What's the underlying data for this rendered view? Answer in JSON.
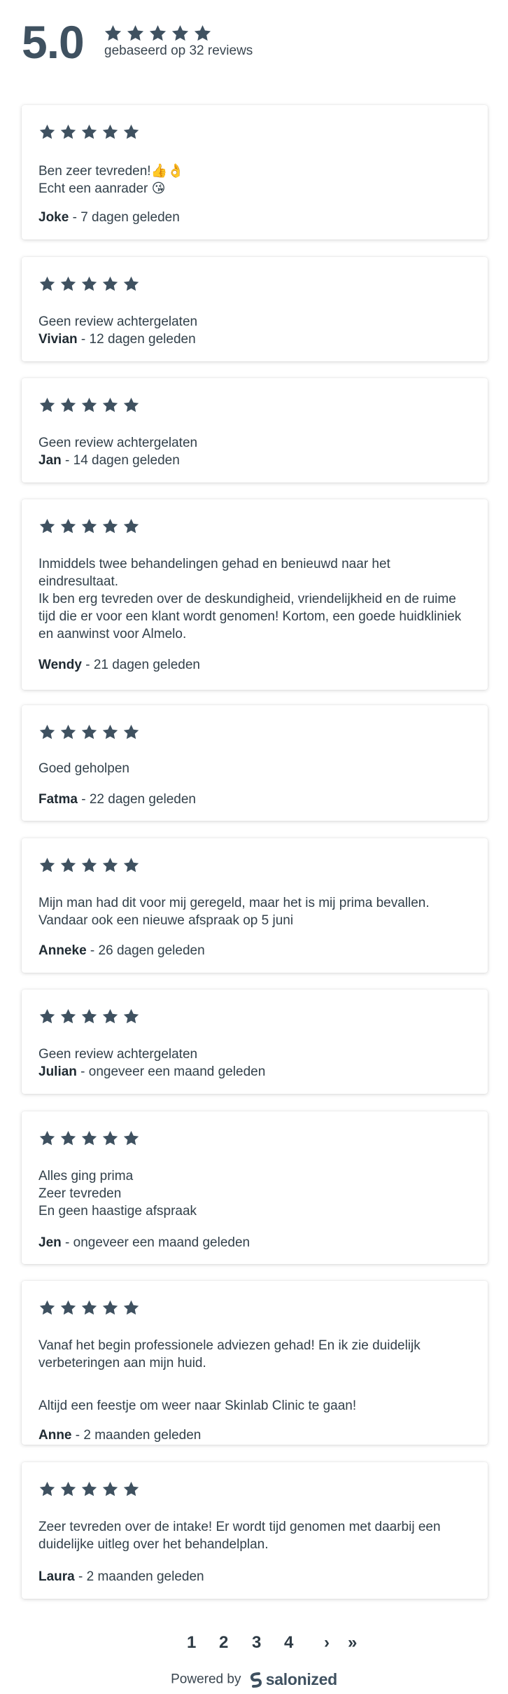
{
  "summary": {
    "score": "5.0",
    "count_label": "gebaseerd op 32 reviews",
    "rating": 5
  },
  "colors": {
    "star": "#3f5160",
    "text": "#33414b"
  },
  "reviews": [
    {
      "lines": [
        "Ben zeer tevreden!👍👌",
        "Echt een aanrader 😘"
      ],
      "name": "Joke",
      "when": " - 7 dagen geleden",
      "rating": 5
    },
    {
      "lines": [
        "Geen review achtergelaten"
      ],
      "name": "Vivian",
      "when": " - 12 dagen geleden",
      "rating": 5
    },
    {
      "lines": [
        "Geen review achtergelaten"
      ],
      "name": "Jan",
      "when": " - 14 dagen geleden",
      "rating": 5
    },
    {
      "lines": [
        "Inmiddels twee behandelingen gehad en benieuwd naar het eindresultaat.",
        "Ik ben erg tevreden over de deskundigheid, vriendelijkheid en de ruime tijd die er voor een klant wordt genomen! Kortom, een goede huidkliniek en aanwinst voor Almelo."
      ],
      "name": "Wendy",
      "when": " - 21 dagen geleden",
      "rating": 5
    },
    {
      "lines": [
        "Goed geholpen"
      ],
      "name": "Fatma",
      "when": " - 22 dagen geleden",
      "rating": 5
    },
    {
      "lines": [
        "Mijn man had dit voor mij geregeld, maar het is mij prima bevallen. Vandaar ook een nieuwe afspraak op 5 juni"
      ],
      "name": "Anneke",
      "when": " - 26 dagen geleden",
      "rating": 5
    },
    {
      "lines": [
        "Geen review achtergelaten"
      ],
      "name": "Julian",
      "when": " - ongeveer een maand geleden",
      "rating": 5
    },
    {
      "lines": [
        "Alles ging prima",
        "Zeer tevreden",
        "En geen haastige afspraak"
      ],
      "name": "Jen",
      "when": " - ongeveer een maand geleden",
      "rating": 5
    },
    {
      "lines": [
        "Vanaf het begin professionele adviezen gehad! En ik zie duidelijk verbeteringen aan mijn huid.",
        "Altijd een feestje om weer naar Skinlab Clinic te gaan!"
      ],
      "name": "Anne",
      "when": " - 2 maanden geleden",
      "rating": 5
    },
    {
      "lines": [
        "Zeer tevreden over de intake! Er wordt tijd genomen met daarbij een duidelijke uitleg over het behandelplan."
      ],
      "name": "Laura",
      "when": " - 2 maanden geleden",
      "rating": 5
    }
  ],
  "pagination": {
    "pages": [
      "1",
      "2",
      "3",
      "4"
    ],
    "current": "1",
    "next": "›",
    "last": "»"
  },
  "footer": {
    "powered_by": "Powered by",
    "brand": "salonized"
  }
}
